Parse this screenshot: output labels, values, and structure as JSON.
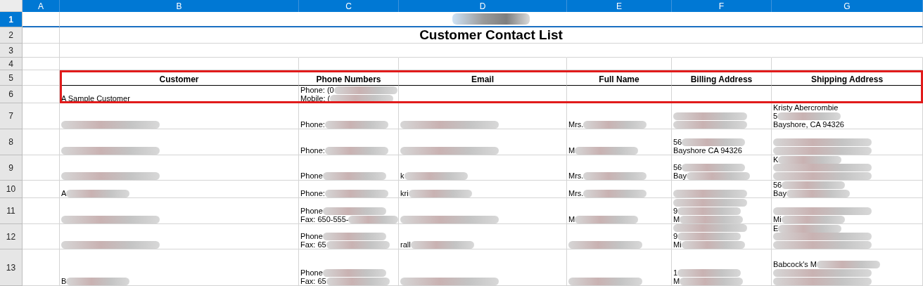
{
  "columns": [
    "A",
    "B",
    "C",
    "D",
    "E",
    "F",
    "G"
  ],
  "rows": [
    {
      "number": "1",
      "selected": true,
      "kind": "banner",
      "redacted": true
    },
    {
      "number": "2",
      "selected": false,
      "kind": "title",
      "text": "Customer Contact List"
    },
    {
      "number": "3",
      "selected": false,
      "kind": "blank"
    },
    {
      "number": "4",
      "selected": false,
      "kind": "blank"
    },
    {
      "number": "5",
      "selected": false,
      "kind": "header",
      "highlighted": true,
      "cells": [
        "Customer",
        "Phone Numbers",
        "Email",
        "Full Name",
        "Billing Address",
        "Shipping Address"
      ]
    },
    {
      "number": "6",
      "selected": false,
      "kind": "data",
      "highlighted": true,
      "cells": [
        {
          "lines": [
            {
              "text": "A Sample Customer",
              "redacted": false
            }
          ]
        },
        {
          "lines": [
            {
              "text": "Phone: (0",
              "redacted": true
            },
            {
              "text": "Mobile: (",
              "redacted": true
            }
          ]
        },
        {},
        {},
        {},
        {}
      ]
    },
    {
      "number": "7",
      "selected": false,
      "kind": "data",
      "highlighted": false,
      "cells": [
        {
          "lines": [
            {
              "redacted": true
            }
          ]
        },
        {
          "lines": [
            {
              "text": "Phone:",
              "redacted": true
            }
          ]
        },
        {
          "lines": [
            {
              "redacted": true
            }
          ]
        },
        {
          "lines": [
            {
              "text": "Mrs.",
              "redacted": true
            }
          ]
        },
        {
          "lines": [
            {
              "redacted": true
            },
            {
              "redacted": true
            }
          ]
        },
        {
          "lines": [
            {
              "text": "Kristy Abercrombie",
              "redacted": false
            },
            {
              "text": "5",
              "redacted": true
            },
            {
              "text": "Bayshore, CA 94326",
              "redacted": false
            }
          ]
        }
      ]
    },
    {
      "number": "8",
      "selected": false,
      "kind": "data",
      "highlighted": false,
      "cells": [
        {
          "lines": [
            {
              "redacted": true
            }
          ]
        },
        {
          "lines": [
            {
              "text": "Phone:",
              "redacted": true
            }
          ]
        },
        {
          "lines": [
            {
              "redacted": true
            }
          ]
        },
        {
          "lines": [
            {
              "text": "M",
              "redacted": true
            }
          ]
        },
        {
          "lines": [
            {
              "text": "56",
              "redacted": true
            },
            {
              "text": "Bayshore CA 94326",
              "redacted": false
            }
          ]
        },
        {
          "lines": [
            {
              "redacted": true
            },
            {
              "redacted": true
            }
          ]
        }
      ]
    },
    {
      "number": "9",
      "selected": false,
      "kind": "data",
      "highlighted": false,
      "cells": [
        {
          "lines": [
            {
              "redacted": true
            }
          ]
        },
        {
          "lines": [
            {
              "text": "Phone",
              "redacted": true
            }
          ]
        },
        {
          "lines": [
            {
              "text": "k",
              "redacted": true
            }
          ]
        },
        {
          "lines": [
            {
              "text": "Mrs.",
              "redacted": true
            }
          ]
        },
        {
          "lines": [
            {
              "text": "56",
              "redacted": true
            },
            {
              "text": "Bay",
              "redacted": true
            }
          ]
        },
        {
          "lines": [
            {
              "text": "K",
              "redacted": true
            },
            {
              "redacted": true
            },
            {
              "redacted": true
            }
          ]
        }
      ]
    },
    {
      "number": "10",
      "selected": false,
      "kind": "data",
      "highlighted": false,
      "cells": [
        {
          "lines": [
            {
              "text": "A",
              "redacted": true
            }
          ]
        },
        {
          "lines": [
            {
              "text": "Phone:",
              "redacted": true
            }
          ]
        },
        {
          "lines": [
            {
              "text": "kri",
              "redacted": true
            }
          ]
        },
        {
          "lines": [
            {
              "text": "Mrs.",
              "redacted": true
            }
          ]
        },
        {
          "lines": [
            {
              "redacted": true
            }
          ]
        },
        {
          "lines": [
            {
              "text": "56",
              "redacted": true
            },
            {
              "text": "Bay",
              "redacted": true
            }
          ]
        }
      ]
    },
    {
      "number": "11",
      "selected": false,
      "kind": "data",
      "highlighted": false,
      "cells": [
        {
          "lines": [
            {
              "redacted": true
            }
          ]
        },
        {
          "lines": [
            {
              "text": "Phone",
              "redacted": true
            },
            {
              "text": "Fax: 650-555-",
              "redacted": true
            }
          ]
        },
        {
          "lines": [
            {
              "redacted": true
            }
          ]
        },
        {
          "lines": [
            {
              "text": "M",
              "redacted": true
            }
          ]
        },
        {
          "lines": [
            {
              "redacted": true
            },
            {
              "text": "9",
              "redacted": true
            },
            {
              "text": "M",
              "redacted": true
            }
          ]
        },
        {
          "lines": [
            {
              "redacted": true
            },
            {
              "text": "Mi",
              "redacted": true
            }
          ]
        }
      ]
    },
    {
      "number": "12",
      "selected": false,
      "kind": "data",
      "highlighted": false,
      "cells": [
        {
          "lines": [
            {
              "redacted": true
            }
          ]
        },
        {
          "lines": [
            {
              "text": "Phone",
              "redacted": true
            },
            {
              "text": "Fax: 65",
              "redacted": true
            }
          ]
        },
        {
          "lines": [
            {
              "text": "rall",
              "redacted": true
            }
          ]
        },
        {
          "lines": [
            {
              "redacted": true
            }
          ]
        },
        {
          "lines": [
            {
              "redacted": true
            },
            {
              "text": "9",
              "redacted": true
            },
            {
              "text": "Mi",
              "redacted": true
            }
          ]
        },
        {
          "lines": [
            {
              "text": "E",
              "redacted": true
            },
            {
              "redacted": true
            },
            {
              "redacted": true
            }
          ]
        }
      ]
    },
    {
      "number": "13",
      "selected": false,
      "kind": "data",
      "highlighted": false,
      "cells": [
        {
          "lines": [
            {
              "text": "B",
              "redacted": true
            }
          ]
        },
        {
          "lines": [
            {
              "text": "Phone",
              "redacted": true
            },
            {
              "text": "Fax: 65",
              "redacted": true
            }
          ]
        },
        {
          "lines": [
            {
              "redacted": true
            }
          ]
        },
        {
          "lines": [
            {
              "redacted": true
            }
          ]
        },
        {
          "lines": [
            {
              "text": "1",
              "redacted": true
            },
            {
              "text": "M",
              "redacted": true
            }
          ]
        },
        {
          "lines": [
            {
              "text": "Babcock's M",
              "redacted": true
            },
            {
              "redacted": true
            },
            {
              "redacted": true
            }
          ]
        }
      ]
    }
  ]
}
